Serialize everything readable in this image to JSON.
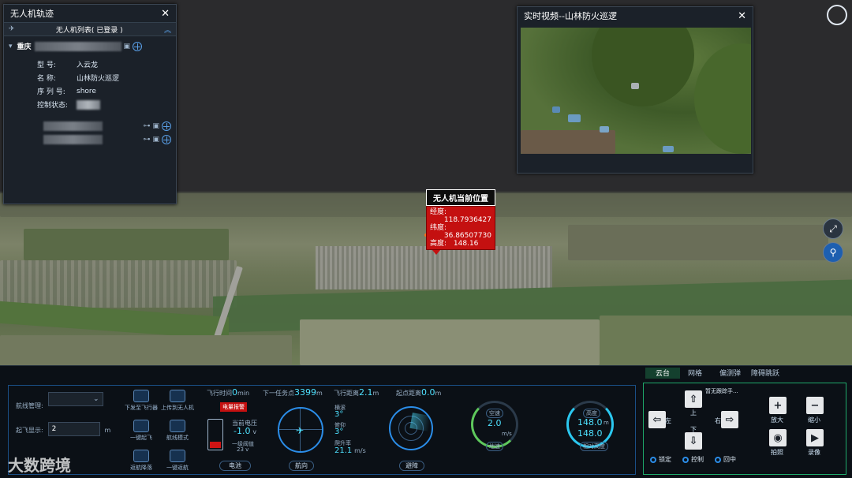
{
  "trajectory_panel": {
    "title": "无人机轨迹",
    "list_title": "无人机列表( 已登录 )",
    "group_label": "重庆",
    "fields": [
      {
        "key": "型 号:",
        "value": "入云龙"
      },
      {
        "key": "名 称:",
        "value": "山林防火巡逻"
      },
      {
        "key": "序 列 号:",
        "value": "shore"
      },
      {
        "key": "控制状态:",
        "value": ""
      }
    ]
  },
  "video_panel": {
    "title": "实时视频--山林防火巡逻"
  },
  "popup": {
    "title": "无人机当前位置",
    "lon_label": "经度:",
    "lon": "118.7936427",
    "lat_label": "纬度:",
    "lat": "36.86507730",
    "alt_label": "高度:",
    "alt": "148.16"
  },
  "left_controls": {
    "route_label": "航线管理:",
    "height_label": "起飞显示:",
    "height_value": "2",
    "height_unit": "m",
    "buttons": [
      "下发至飞行器",
      "上传到无人机",
      "一键起飞",
      "航线模式",
      "返航降落",
      "一键返航"
    ]
  },
  "telemetry": {
    "flight_time_label": "飞行时间",
    "flight_time_value": "0",
    "flight_time_unit": "min",
    "next_wp_label": "下一任务点",
    "next_wp_value": "3399",
    "next_wp_unit": "m",
    "flight_dist_label": "飞行距离",
    "flight_dist_value": "2.1",
    "flight_dist_unit": "m",
    "home_dist_label": "起点距离",
    "home_dist_value": "0.0",
    "home_dist_unit": "m",
    "battery_warning": "电量报警",
    "voltage_label": "当前电压",
    "voltage_value": "-1.0",
    "voltage_unit": "v",
    "threshold_label": "一级阈值",
    "threshold_value": "23 v",
    "battery_tab": "电池",
    "attitude_tab": "航向",
    "radar_tab": "避障",
    "roll_label": "横滚",
    "roll_value": "3°",
    "pitch_label": "俯仰",
    "pitch_value": "3°",
    "climb_label": "爬升率",
    "climb_value": "21.1",
    "climb_unit": "m/s",
    "speed_label": "空速",
    "speed_value": "2.0",
    "speed_unit": "m/s",
    "ground_label": "地速",
    "alt_label_top": "高度",
    "alt_value1": "148.0",
    "alt_value2": "148.0",
    "alt_unit": "m",
    "alt_label_bottom": "相对高度"
  },
  "gimbal": {
    "tabs": [
      "云台",
      "网格",
      "偏测弹",
      "障碍跳跃"
    ],
    "mode_label": "暂无跟踪手...",
    "left": "左",
    "up": "上",
    "down": "下",
    "right": "右",
    "zoom_in": "放大",
    "zoom_out": "缩小",
    "photo": "拍照",
    "record": "录像",
    "radios": [
      "锁定",
      "控制",
      "回中"
    ]
  },
  "watermark": {
    "text": "大数跨境"
  },
  "colors": {
    "accent": "#2b8de8",
    "alarm": "#c41010",
    "gauge": "#4ee1ff"
  }
}
